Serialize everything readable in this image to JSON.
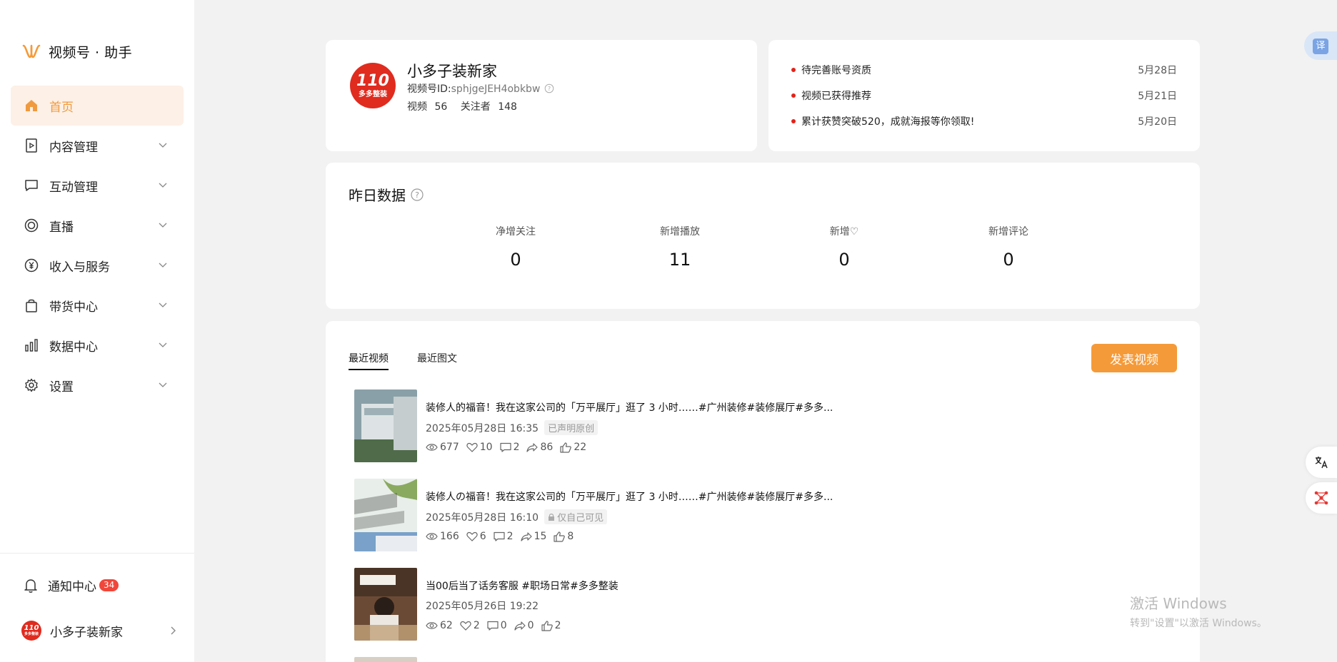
{
  "sidebar": {
    "brand": "视频号 · 助手",
    "items": [
      {
        "label": "首页",
        "icon": "home-icon"
      },
      {
        "label": "内容管理",
        "icon": "content-icon"
      },
      {
        "label": "互动管理",
        "icon": "chat-icon"
      },
      {
        "label": "直播",
        "icon": "live-icon"
      },
      {
        "label": "收入与服务",
        "icon": "yen-icon"
      },
      {
        "label": "带货中心",
        "icon": "bag-icon"
      },
      {
        "label": "数据中心",
        "icon": "bar-chart-icon"
      },
      {
        "label": "设置",
        "icon": "gear-icon"
      }
    ],
    "notifications": {
      "label": "通知中心",
      "count": "34"
    },
    "user": {
      "name": "小多子装新家"
    }
  },
  "profile": {
    "avatar_big": "110",
    "avatar_small": "多多整装",
    "name": "小多子装新家",
    "id_label": "视频号ID:",
    "id_value": "sphjgeJEH4obkbw",
    "videos_label": "视频",
    "videos_count": "56",
    "followers_label": "关注者",
    "followers_count": "148"
  },
  "notices": [
    {
      "text": "待完善账号资质",
      "date": "5月28日"
    },
    {
      "text": "视频已获得推荐",
      "date": "5月21日"
    },
    {
      "text": "累计获赞突破520，成就海报等你领取!",
      "date": "5月20日"
    }
  ],
  "yesterday": {
    "title": "昨日数据",
    "stats": [
      {
        "label": "净增关注",
        "value": "0"
      },
      {
        "label": "新增播放",
        "value": "11"
      },
      {
        "label": "新增♡",
        "value": "0"
      },
      {
        "label": "新增评论",
        "value": "0"
      }
    ]
  },
  "recent": {
    "tabs": [
      "最近视频",
      "最近图文"
    ],
    "publish_label": "发表视频",
    "videos": [
      {
        "title": "装修人的福音！我在这家公司的「万平展厅」逛了 3 小时……#广州装修#装修展厅#多多...",
        "date": "2025年05月28日 16:35",
        "tag": "已声明原创",
        "views": "677",
        "likes": "10",
        "comments": "2",
        "shares": "86",
        "thumbs": "22"
      },
      {
        "title": "装修人の福音！我在这家公司的「万平展厅」逛了 3 小时……#广州装修#装修展厅#多多...",
        "date": "2025年05月28日 16:10",
        "tag": "仅自己可见",
        "views": "166",
        "likes": "6",
        "comments": "2",
        "shares": "15",
        "thumbs": "8"
      },
      {
        "title": "当00后当了话务客服 #职场日常#多多整装",
        "date": "2025年05月26日 19:22",
        "tag": "",
        "views": "62",
        "likes": "2",
        "comments": "0",
        "shares": "0",
        "thumbs": "2"
      }
    ]
  },
  "float": {
    "translate": "译"
  },
  "watermark": {
    "line1": "激活 Windows",
    "line2": "转到\"设置\"以激活 Windows。"
  },
  "colors": {
    "accent": "#f59a38",
    "active_bg": "#fdf0e6",
    "badge": "#f0473a",
    "dot": "#e2231a"
  }
}
